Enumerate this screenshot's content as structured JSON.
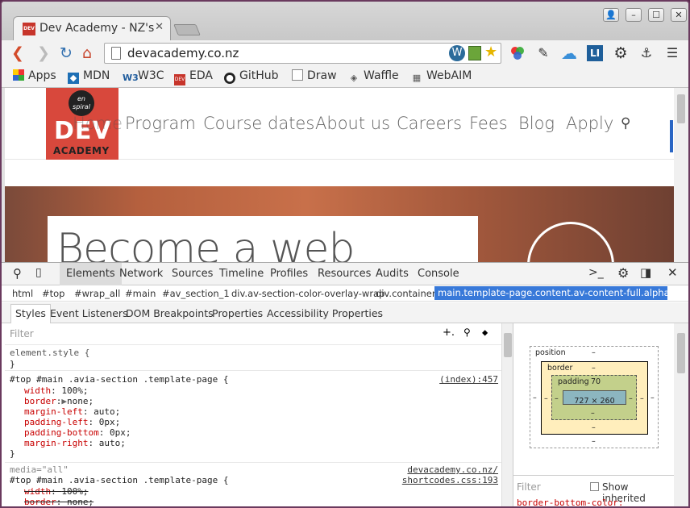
{
  "browser": {
    "tab_title": "Dev Academy - NZ's",
    "tab_favicon": "DEV",
    "url": "devacademy.co.nz"
  },
  "bookmarks": [
    {
      "label": "Apps",
      "icon": "apps-grid-icon"
    },
    {
      "label": "MDN",
      "icon": "mdn-icon"
    },
    {
      "label": "W3C",
      "icon": "w3c-icon"
    },
    {
      "label": "EDA",
      "icon": "eda-icon"
    },
    {
      "label": "GitHub",
      "icon": "github-icon"
    },
    {
      "label": "Draw",
      "icon": "draw-icon"
    },
    {
      "label": "Waffle",
      "icon": "waffle-icon"
    },
    {
      "label": "WebAIM",
      "icon": "webaim-icon"
    }
  ],
  "site": {
    "logo_top": "en spiral",
    "logo_main": "DEV",
    "logo_sub": "ACADEMY",
    "nav": [
      "Home",
      "Program",
      "Course dates",
      "About us",
      "Careers",
      "Fees",
      "Blog",
      "Apply"
    ],
    "hero_heading": "Become a web"
  },
  "devtools": {
    "tabs": [
      "Elements",
      "Network",
      "Sources",
      "Timeline",
      "Profiles",
      "Resources",
      "Audits",
      "Console"
    ],
    "breadcrumbs": [
      "html",
      "#top",
      "#wrap_all",
      "#main",
      "#av_section_1",
      "div.av-section-color-overlay-wrap",
      "div.container",
      "main.template-page.content.av-content-full.alpha.units"
    ],
    "subtabs": [
      "Styles",
      "Event Listeners",
      "DOM Breakpoints",
      "Properties",
      "Accessibility Properties"
    ],
    "filter_placeholder": "Filter",
    "element_style": "element.style {",
    "close_brace": "}",
    "rule1": {
      "selector": "#top #main .avia-section .template-page {",
      "source": "(index):457",
      "props": [
        {
          "name": "width",
          "value": "100%;"
        },
        {
          "name": "border",
          "value": "none;"
        },
        {
          "name": "margin-left",
          "value": "auto;"
        },
        {
          "name": "padding-left",
          "value": "0px;"
        },
        {
          "name": "padding-bottom",
          "value": "0px;"
        },
        {
          "name": "margin-right",
          "value": "auto;"
        }
      ]
    },
    "rule2": {
      "media": "media=\"all\"",
      "source1": "devacademy.co.nz/",
      "selector": "#top #main .avia-section .template-page {",
      "source2": "shortcodes.css:193",
      "props": [
        {
          "name": "width",
          "value": "100%;"
        },
        {
          "name": "border",
          "value": "none;"
        }
      ]
    },
    "metrics": {
      "position_label": "position",
      "position_value": "–",
      "border_label": "border",
      "border_value": "–",
      "padding_label": "padding",
      "padding_value": "70",
      "content_size": "727 × 260",
      "dash": "–"
    },
    "computed_filter": "Filter",
    "show_inherited": "Show inherited",
    "computed_peek": "border-bottom-color:"
  }
}
